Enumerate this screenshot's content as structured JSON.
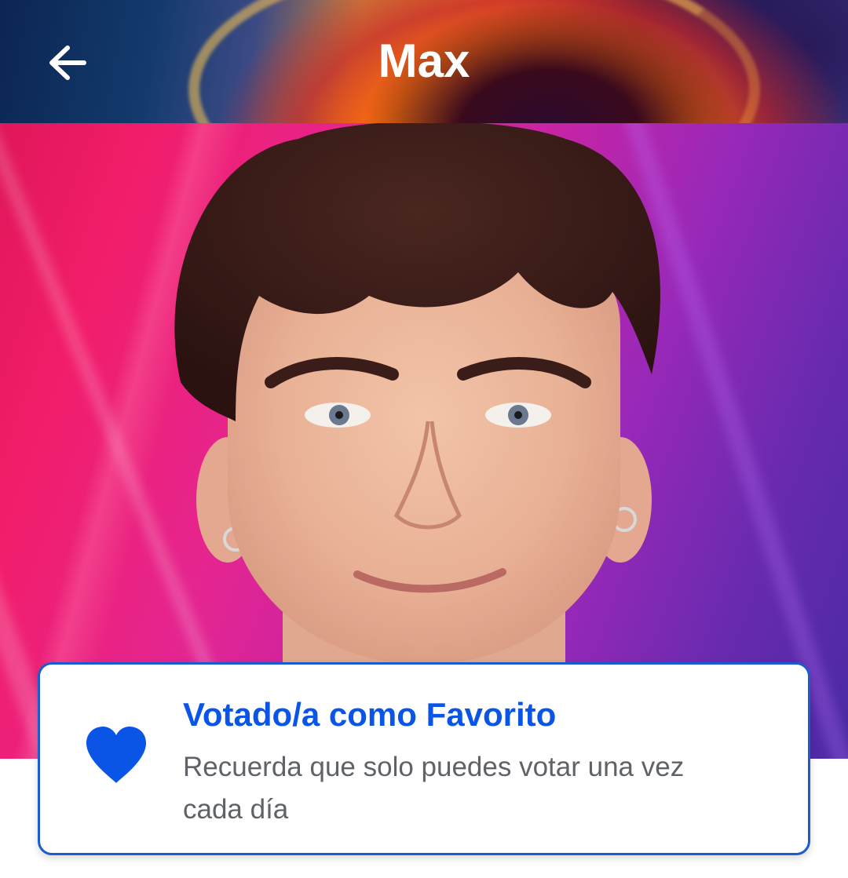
{
  "header": {
    "title": "Max",
    "back_icon": "arrow-left-icon"
  },
  "portrait": {
    "subject": "contestant-photo"
  },
  "vote_card": {
    "icon": "heart-icon",
    "title": "Votado/a como Favorito",
    "message": "Recuerda que solo puedes votar una vez cada día"
  },
  "colors": {
    "accent": "#0a55e6",
    "card_border": "#1a5ccf",
    "message_text": "#5f6368",
    "title_text": "#ffffff"
  }
}
